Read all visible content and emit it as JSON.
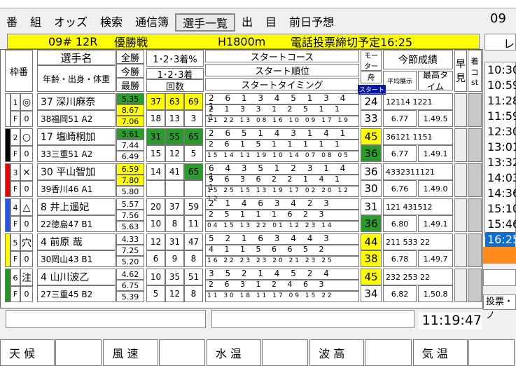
{
  "menu": [
    "番",
    "組",
    "オッズ",
    "検索",
    "通信簿",
    "選手一覧",
    "出",
    "目",
    "前日予想"
  ],
  "race_header": {
    "race": "09# 12R",
    "name": "優勝戦",
    "distance": "H1800m",
    "deadline": "電話投票締切予定16:25"
  },
  "corner_text": "09",
  "right_button": "レ",
  "columns": {
    "waku": "枠番",
    "player": "選手名",
    "player_sub": "年齢・出身・体重",
    "zenshou": "全勝",
    "konshou": "今勝",
    "saishou": "最勝",
    "rate": "1･2･3着%",
    "rate2": "1･2･3着",
    "count": "回数",
    "course": "スタートコース",
    "order": "スタート順位",
    "timing": "スタートタイミング",
    "motor": "モーター",
    "boat": "舟",
    "setsu": "今節成績",
    "heikin": "平均展示",
    "saiko": "最高タイム",
    "start_tag": "スタート",
    "haya": "早見",
    "chaku": "着コst"
  },
  "racers": [
    {
      "waku": "1",
      "mark1": "◎",
      "mark2": "◎",
      "f": "F",
      "fv": "0",
      "age": "37",
      "name": "深川麻奈",
      "home": "38福岡51 A2",
      "rates": [
        "5.35",
        "8.67",
        "7.06"
      ],
      "pct": [
        "37",
        "63",
        "69"
      ],
      "cnt": [
        "18",
        "13",
        "3"
      ],
      "course": "2 6 1 3 4 5 1 3 4 1",
      "order": "2 1 3 3 1 2 5 1 1 1",
      "timing": "11 22 13 08 16 10 09 17 19",
      "motor": "24",
      "boat": "33",
      "setsu": "12114 1221",
      "avg": "6.77",
      "best": "1.49.5"
    },
    {
      "waku": "2",
      "mark1": "○",
      "mark2": "△",
      "f": "F",
      "fv": "0",
      "age": "17",
      "name": "塩崎桐加",
      "home": "33三重51 A2",
      "rates": [
        "5.61",
        "7.44",
        "6.49"
      ],
      "pct": [
        "31",
        "55",
        "65"
      ],
      "cnt": [
        "15",
        "12",
        "5"
      ],
      "course": "2 6 5 1 4 3 1 4 1",
      "order": "2 6 1 5 1 1 1 1 1",
      "timing": "15 14 11 19 10 14 07 08 05",
      "motor": "45",
      "boat": "36",
      "setsu": "36121 1151",
      "avg": "6.77",
      "best": "1.49.1"
    },
    {
      "waku": "3",
      "mark1": "×",
      "mark2": "○",
      "f": "F",
      "fv": "0",
      "age": "30",
      "name": "平山智加",
      "home": "39香川46 A1",
      "rates": [
        "6.59",
        "7.80",
        "5.80"
      ],
      "pct": [
        "14",
        "41",
        "65"
      ],
      "cnt": [
        "",
        "",
        ""
      ],
      "course": "6 4 3 5 1 2 3 1 4 1",
      "order": "5 6 3 6 2 2 1 4 1 1",
      "timing": "15 25 15 13 19 17 02 20 12 12",
      "motor": "36",
      "boat": "30",
      "setsu": "4332311121",
      "avg": "6.76",
      "best": "1.49.0"
    },
    {
      "waku": "4",
      "mark1": "△",
      "mark2": "×",
      "f": "F",
      "fv": "0",
      "age": "8",
      "name": "井上遥妃",
      "home": "22徳島47 B1",
      "rates": [
        "5.57",
        "7.56",
        "5.63"
      ],
      "pct": [
        "20",
        "37",
        "59"
      ],
      "cnt": [
        "10",
        "8",
        "11"
      ],
      "course": "2 1 4 6 3 4 2 3",
      "order": "2 5 1 1 1 6 2 3",
      "timing": "04 15 13 22 01 12 23 14",
      "motor": "31",
      "boat": "36",
      "setsu": "121 431512",
      "avg": "6.80",
      "best": "1.49.1"
    },
    {
      "waku": "5",
      "mark1": "穴",
      "mark2": "穴",
      "f": "F",
      "fv": "0",
      "age": "4",
      "name": "前原 哉",
      "home": "30岡山43 B1",
      "rates": [
        "4.33",
        "7.25",
        "5.20"
      ],
      "pct": [
        "12",
        "31",
        "47"
      ],
      "cnt": [
        "6",
        "9",
        "8"
      ],
      "course": "5 2 1 6 3 4 4 3",
      "order": "4 1 1 5 6 6 5 2",
      "timing": "16 22 23 23 20 21 23 25",
      "motor": "44",
      "boat": "38",
      "setsu": "211 533 22",
      "avg": "6.78",
      "best": "1.49.7"
    },
    {
      "waku": "6",
      "mark1": "注",
      "mark2": "注",
      "f": "F",
      "fv": "0",
      "age": "4",
      "name": "山川波乙",
      "home": "27三重45 B2",
      "rates": [
        "4.62",
        "6.75",
        "5.39"
      ],
      "pct": [
        "10",
        "35",
        "51"
      ],
      "cnt": [
        "5",
        "12",
        "8"
      ],
      "course": "3 5 2 1 4 5 2 4",
      "order": "2 6 3 1 2 4 6 3",
      "timing": "11 30 18 11 17 09 15 22",
      "motor": "45",
      "boat": "34",
      "setsu": "232 253 22",
      "avg": "6.82",
      "best": "1.50.8"
    }
  ],
  "times": [
    "10:30",
    "10:59",
    "11:28",
    "11:59",
    "12:30",
    "13:01",
    "13:32",
    "14:03",
    "14:36",
    "15:10",
    "15:46",
    "16:25"
  ],
  "clock": "11:19:47",
  "toohyo": "投票・ノ",
  "bottom": [
    "天 候",
    "風 速",
    "水 温",
    "波 高",
    "気 温"
  ],
  "colors": {
    "w1": "#fff",
    "w2": "#000",
    "w3": "#e00",
    "w4": "#2255ee",
    "w5": "#ff0",
    "w6": "#1a9c1a"
  }
}
